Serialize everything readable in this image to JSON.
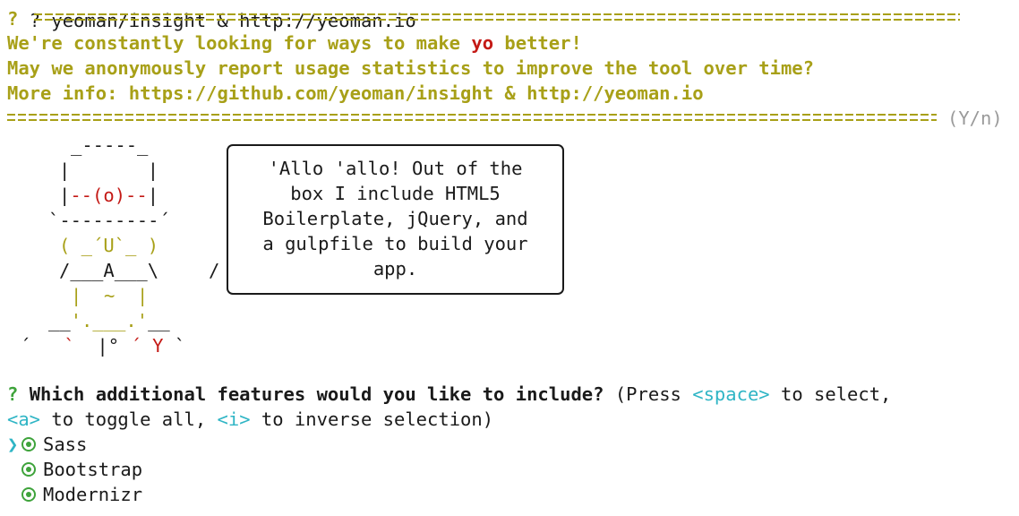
{
  "terminal": {
    "top_cut_line": "? yeoman/insight & http://yeoman.io",
    "prompt_mark": "?",
    "insight_line1_pre": "We're constantly looking for ways to make ",
    "insight_line1_brand": "yo",
    "insight_line1_post": " better!",
    "insight_line2": "May we anonymously report usage statistics to improve the tool over time?",
    "insight_line3": "More info: https://github.com/yeoman/insight & http://yeoman.io",
    "insight_choice": "(Y/n)"
  },
  "yeoman_art": {
    "hat_top": "_-----_",
    "head_side": "|       |",
    "face": "|--(o)--|",
    "brim": "`---------´",
    "mouth": "( _´U`_ )",
    "body": "/___A___\\",
    "slash": "/",
    "legs": "|  ~  |",
    "feet_left": "__'.___.'__",
    "base": "´   `  |° ´ Y `"
  },
  "speech_bubble": {
    "lines": [
      "'Allo 'allo! Out of the",
      "box I include HTML5",
      "Boilerplate, jQuery, and",
      "a gulpfile to build your",
      "app."
    ]
  },
  "question": {
    "mark": "?",
    "text": "Which additional features would you like to include?",
    "hint_pre": " (Press ",
    "key_space": "<space>",
    "hint_mid1": " to select,",
    "key_a": "<a>",
    "hint_mid2": " to toggle all, ",
    "key_i": "<i>",
    "hint_post": " to inverse selection)"
  },
  "features": [
    {
      "label": "Sass",
      "selected": true,
      "active": true
    },
    {
      "label": "Bootstrap",
      "selected": true,
      "active": false
    },
    {
      "label": "Modernizr",
      "selected": true,
      "active": false
    }
  ],
  "colors": {
    "prompt": "#a8a018",
    "brand": "#c41a16",
    "accent": "#2fb5c5",
    "check": "#3ea33b",
    "muted": "#9a9a9a"
  }
}
